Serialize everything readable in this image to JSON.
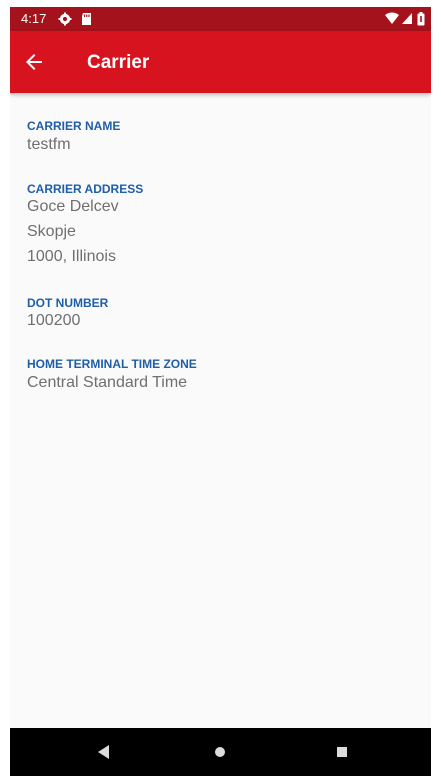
{
  "status_bar": {
    "time": "4:17"
  },
  "app_bar": {
    "title": "Carrier"
  },
  "fields": {
    "carrier_name": {
      "label": "CARRIER NAME",
      "value": "testfm"
    },
    "carrier_address": {
      "label": "CARRIER ADDRESS",
      "lines": [
        "Goce Delcev",
        "Skopje",
        "1000, Illinois"
      ]
    },
    "dot_number": {
      "label": "DOT NUMBER",
      "value": "100200"
    },
    "home_terminal_time_zone": {
      "label": "HOME TERMINAL TIME ZONE",
      "value": "Central Standard Time"
    }
  },
  "icons": {
    "status_left": [
      "settings-icon",
      "sd-card-icon"
    ],
    "status_right": [
      "wifi-icon",
      "signal-icon",
      "battery-icon"
    ],
    "app_bar": "back-arrow-icon",
    "nav": [
      "back-triangle-icon",
      "home-circle-icon",
      "recents-square-icon"
    ]
  },
  "colors": {
    "status_bar": "#a4121b",
    "app_bar": "#d7131f",
    "label": "#1f5ea8",
    "value": "#6f6f6f",
    "nav_bar": "#000000"
  }
}
